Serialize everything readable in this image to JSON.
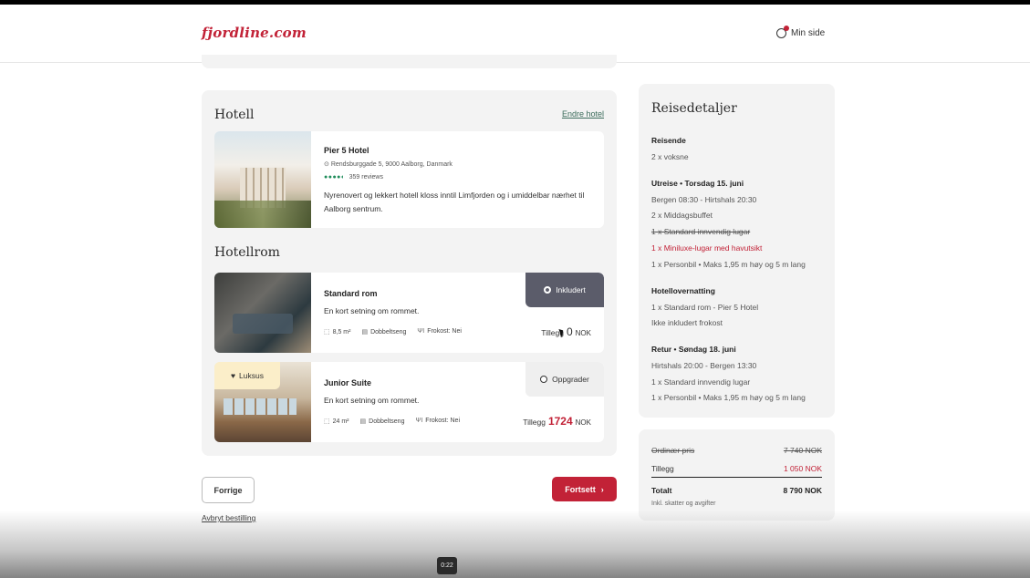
{
  "header": {
    "logo": "fjordline.com",
    "min_side": "Min side",
    "icon": "user-icon"
  },
  "hotel": {
    "section_title": "Hotell",
    "change_link": "Endre hotel",
    "name": "Pier 5 Hotel",
    "address": "Rendsburggade 5, 9000 Aalborg, Danmark",
    "rating_dots": "●●●●◐",
    "reviews": "359 reviews",
    "description": "Nyrenovert og lekkert hotell kloss inntil Limfjorden og i umiddelbar nærhet til Aalborg sentrum."
  },
  "rooms": {
    "section_title": "Hotellrom",
    "items": [
      {
        "name": "Standard rom",
        "subtitle": "En kort setning om rommet.",
        "size": "8,5 m²",
        "bed": "Dobbeltseng",
        "breakfast": "Frokost: Nei",
        "status_label": "Inkludert",
        "tillegg_label": "Tillegg",
        "amount": "0",
        "currency": "NOK"
      },
      {
        "badge": "Luksus",
        "name": "Junior Suite",
        "subtitle": "En kort setning om rommet.",
        "size": "24 m²",
        "bed": "Dobbeltseng",
        "breakfast": "Frokost: Nei",
        "status_label": "Oppgrader",
        "tillegg_label": "Tillegg",
        "amount": "1724",
        "currency": "NOK"
      }
    ]
  },
  "nav": {
    "prev": "Forrige",
    "next": "Fortsett",
    "cancel": "Avbryt bestilling"
  },
  "details": {
    "title": "Reisedetaljer",
    "travelers_h": "Reisende",
    "travelers": "2 x voksne",
    "outbound_h": "Utreise • Torsdag 15. juni",
    "outbound": [
      "Bergen 08:30 - Hirtshals 20:30",
      "2 x Middagsbuffet",
      "1 x Standard innvendig lugar",
      "1 x Miniluxe-lugar med havutsikt",
      "1 x Personbil • Maks 1,95 m høy og 5 m lang"
    ],
    "hotel_h": "Hotellovernatting",
    "hotel": [
      "1 x Standard rom - Pier 5 Hotel",
      "Ikke inkludert frokost"
    ],
    "return_h": "Retur • Søndag 18. juni",
    "return": [
      "Hirtshals 20:00 - Bergen 13:30",
      "1 x Standard innvendig lugar",
      "1 x Personbil • Maks 1,95 m høy og 5 m lang"
    ]
  },
  "price": {
    "ordinary_label": "Ordinær pris",
    "ordinary_value": "7 740 NOK",
    "extra_label": "Tillegg",
    "extra_value": "1 050 NOK",
    "total_label": "Totalt",
    "total_value": "8 790 NOK",
    "note": "Inkl. skatter og avgifter"
  },
  "video": {
    "time": "0:22"
  }
}
